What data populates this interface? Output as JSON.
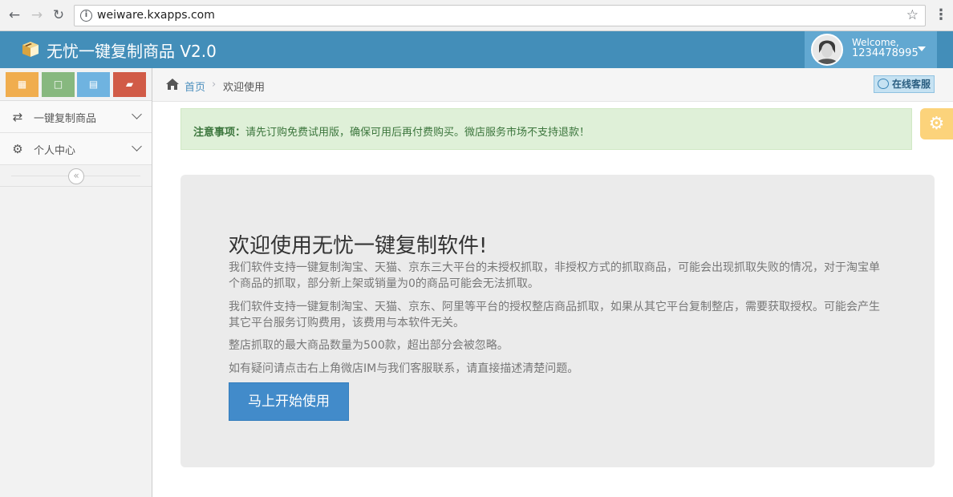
{
  "browser": {
    "url": "weiware.kxapps.com"
  },
  "header": {
    "title": "无忧一键复制商品 V2.0",
    "welcome": "Welcome,",
    "user_id": "1234478995"
  },
  "sidebar": {
    "shortcuts": [
      {
        "name": "calendar-shortcut",
        "color": "#f0ad4e"
      },
      {
        "name": "square-shortcut",
        "color": "#87b87f"
      },
      {
        "name": "grid-shortcut",
        "color": "#6fb3e0"
      },
      {
        "name": "book-shortcut",
        "color": "#d15b47"
      }
    ],
    "items": [
      {
        "label": "一键复制商品",
        "icon": "shuffle-icon"
      },
      {
        "label": "个人中心",
        "icon": "gear-icon"
      }
    ]
  },
  "breadcrumbs": {
    "home": "首页",
    "current": "欢迎使用",
    "service_button": "在线客服"
  },
  "alert": {
    "title": "注意事项：",
    "text": "请先订购免费试用版，确保可用后再付费购买。微店服务市场不支持退款！"
  },
  "main": {
    "title": "欢迎使用无忧一键复制软件!",
    "paragraphs": [
      "我们软件支持一键复制淘宝、天猫、京东三大平台的未授权抓取，非授权方式的抓取商品，可能会出现抓取失败的情况，对于淘宝单个商品的抓取，部分新上架或销量为0的商品可能会无法抓取。",
      "我们软件支持一键复制淘宝、天猫、京东、阿里等平台的授权整店商品抓取，如果从其它平台复制整店，需要获取授权。可能会产生其它平台服务订购费用，该费用与本软件无关。",
      "整店抓取的最大商品数量为500款，超出部分会被忽略。",
      "如有疑问请点击右上角微店IM与我们客服联系，请直接描述清楚问题。"
    ],
    "start_button": "马上开始使用"
  }
}
